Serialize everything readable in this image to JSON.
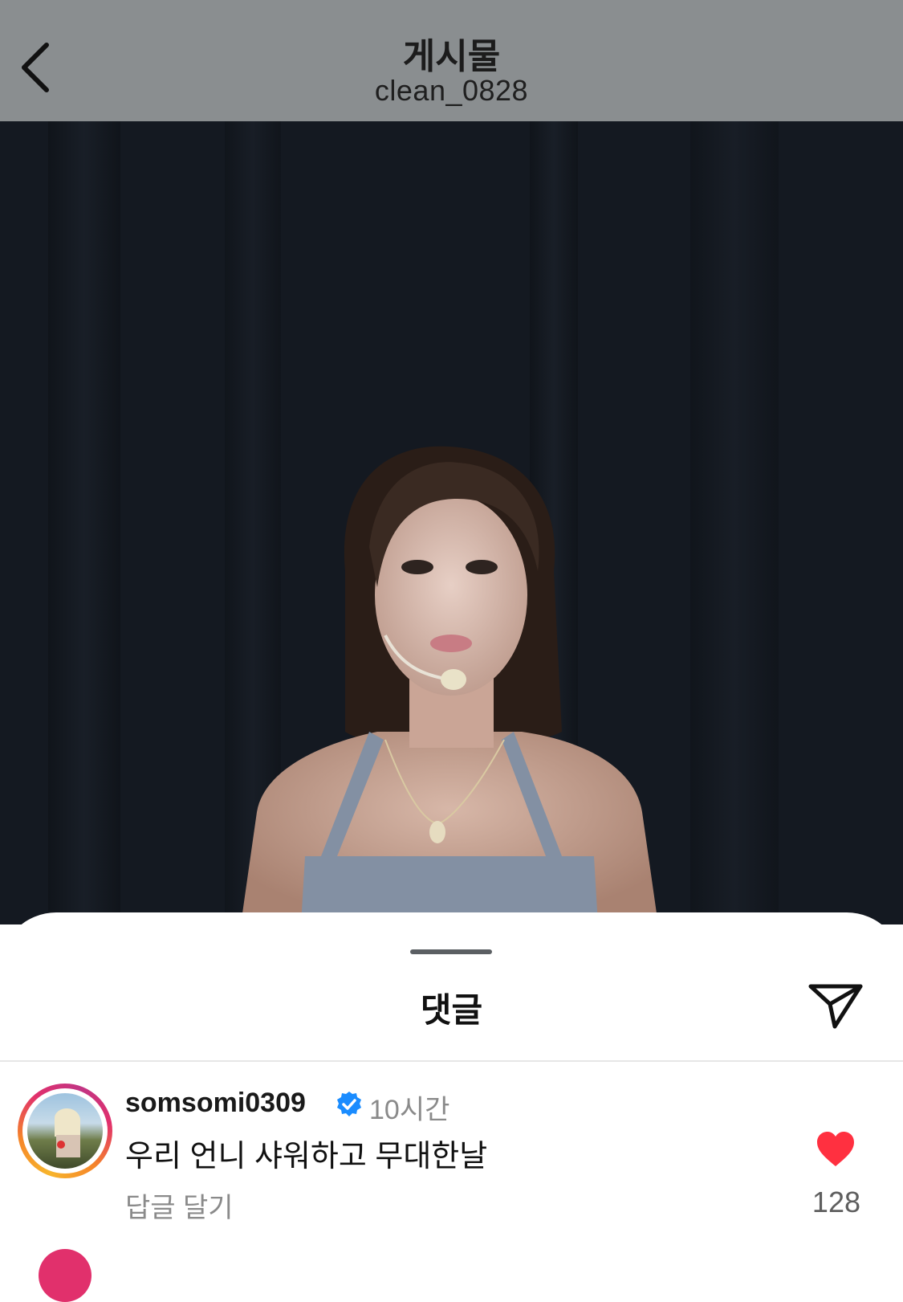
{
  "header": {
    "title": "게시물",
    "subtitle": "clean_0828",
    "back_icon": "chevron-left-icon"
  },
  "photo": {
    "description_icon": "post-photo"
  },
  "sheet": {
    "title": "댓글",
    "share_icon": "send-icon"
  },
  "comment": {
    "username": "somsomi0309",
    "verified_icon": "verified-badge-icon",
    "time": "10시간",
    "text": "우리 언니 샤워하고 무대한날",
    "reply_label": "답글 달기",
    "like_icon": "heart-icon",
    "like_count": "128",
    "like_color": "#ff3040"
  },
  "colors": {
    "header_bg": "#8a8e90",
    "verified": "#1a8cff",
    "story_ring": [
      "#f7b52c",
      "#e1306c",
      "#c13584"
    ]
  }
}
